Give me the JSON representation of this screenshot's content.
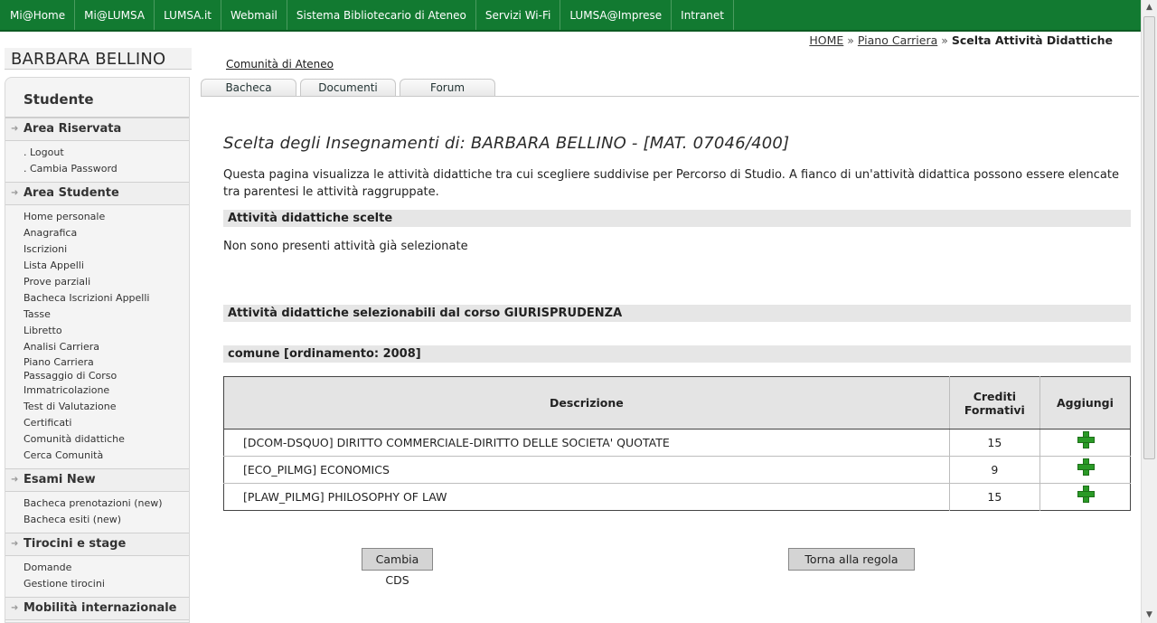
{
  "topnav": [
    "Mi@Home",
    "Mi@LUMSA",
    "LUMSA.it",
    "Webmail",
    "Sistema Bibliotecario di Ateneo",
    "Servizi Wi-Fi",
    "LUMSA@Imprese",
    "Intranet"
  ],
  "breadcrumb": {
    "home": "HOME",
    "sep1": "»",
    "piano": "Piano Carriera",
    "sep2": "»",
    "current": "Scelta Attività Didattiche"
  },
  "user_name": "BARBARA BELLINO",
  "sidebar": {
    "title": "Studente",
    "sections": [
      {
        "label": "Area Riservata",
        "items": [
          ". Logout",
          ". Cambia Password"
        ]
      },
      {
        "label": "Area Studente",
        "items": [
          "Home personale",
          "Anagrafica",
          "Iscrizioni",
          "Lista Appelli",
          "Prove parziali",
          "Bacheca Iscrizioni Appelli",
          "Tasse",
          "Libretto",
          "Analisi Carriera",
          "Piano Carriera",
          "Passaggio di Corso",
          "Immatricolazione",
          "Test di Valutazione",
          "Certificati",
          "Comunità didattiche",
          "Cerca Comunità"
        ]
      },
      {
        "label": "Esami New",
        "items": [
          "Bacheca prenotazioni (new)",
          "Bacheca esiti (new)"
        ]
      },
      {
        "label": "Tirocini e stage",
        "items": [
          "Domande",
          "Gestione tirocini"
        ]
      },
      {
        "label": "Mobilità internazionale",
        "items": []
      }
    ]
  },
  "community_link": "Comunità di Ateneo",
  "tabs": [
    "Bacheca",
    "Documenti",
    "Forum"
  ],
  "main": {
    "title": "Scelta degli Insegnamenti di: BARBARA BELLINO - [MAT. 07046/400]",
    "intro": "Questa pagina visualizza le attività didattiche tra cui scegliere suddivise per Percorso di Studio. A fianco di un'attività didattica possono essere elencate tra parentesi le attività raggruppate.",
    "chosen_header": "Attività didattiche scelte",
    "none_selected": "Non sono presenti attività già selezionate",
    "selectable_header": "Attività didattiche selezionabili dal corso GIURISPRUDENZA",
    "group_header": "comune [ordinamento: 2008]",
    "table": {
      "headers": {
        "description": "Descrizione",
        "credits": "Crediti Formativi",
        "add": "Aggiungi"
      },
      "rows": [
        {
          "description": "[DCOM-DSQUO] DIRITTO COMMERCIALE-DIRITTO DELLE SOCIETA' QUOTATE",
          "credits": "15"
        },
        {
          "description": "[ECO_PILMG] ECONOMICS",
          "credits": "9"
        },
        {
          "description": "[PLAW_PILMG] PHILOSOPHY OF LAW",
          "credits": "15"
        }
      ]
    },
    "buttons": {
      "change_cds": "Cambia CDS",
      "back": "Torna alla regola"
    }
  }
}
